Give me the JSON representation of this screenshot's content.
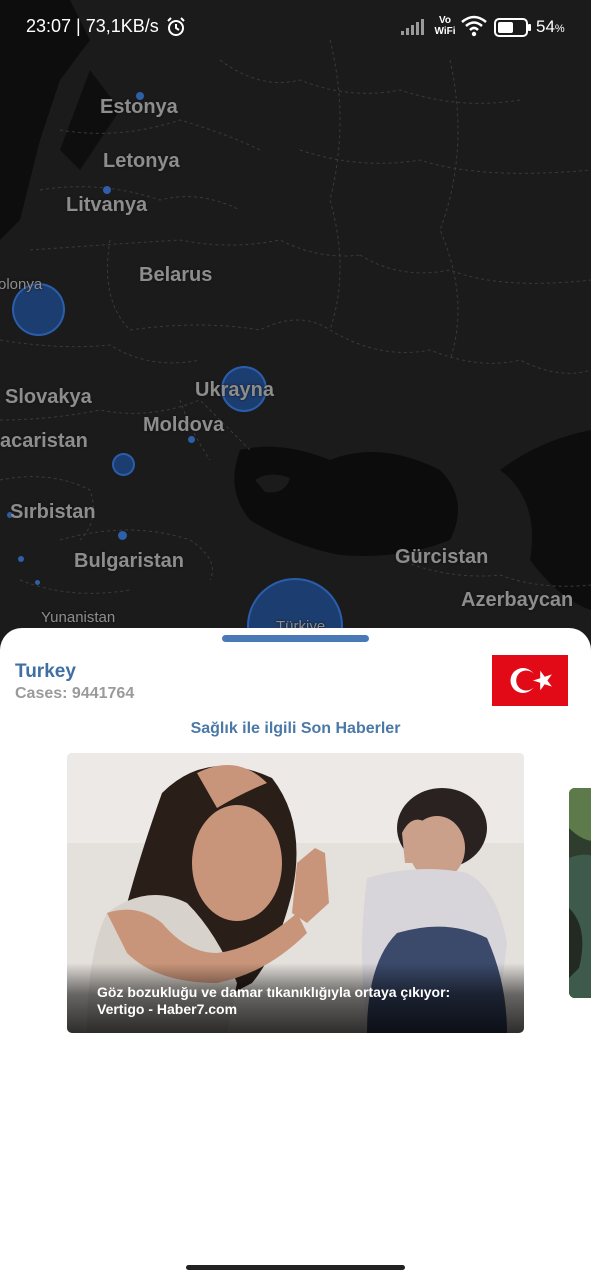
{
  "status_bar": {
    "time_speed": "23:07 | 73,1KB/s",
    "vowifi_top": "Vo",
    "vowifi_bottom": "WiFi",
    "battery_value": "54",
    "battery_unit": "%"
  },
  "map": {
    "labels": {
      "estonia": "Estonya",
      "latvia": "Letonya",
      "lithuania": "Litvanya",
      "poland": "olonya",
      "belarus": "Belarus",
      "ukraine": "Ukrayna",
      "slovakia": "Slovakya",
      "hungary": "acaristan",
      "moldova": "Moldova",
      "serbia": "Sırbistan",
      "bulgaria": "Bulgaristan",
      "georgia": "Gürcistan",
      "azerbaijan": "Azerbaycan",
      "greece": "Yunanistan",
      "turkey": "Türkiye"
    }
  },
  "sheet": {
    "country": "Turkey",
    "cases": "Cases: 9441764",
    "section_title": "Sağlık ile ilgili Son Haberler",
    "news": [
      {
        "caption": "Göz bozukluğu ve damar tıkanıklığıyla ortaya çıkıyor: Vertigo - Haber7.com"
      }
    ]
  },
  "colors": {
    "accent": "#3f6fa3",
    "flag_red": "#e30a17",
    "map_background": "#1b1b1c"
  }
}
